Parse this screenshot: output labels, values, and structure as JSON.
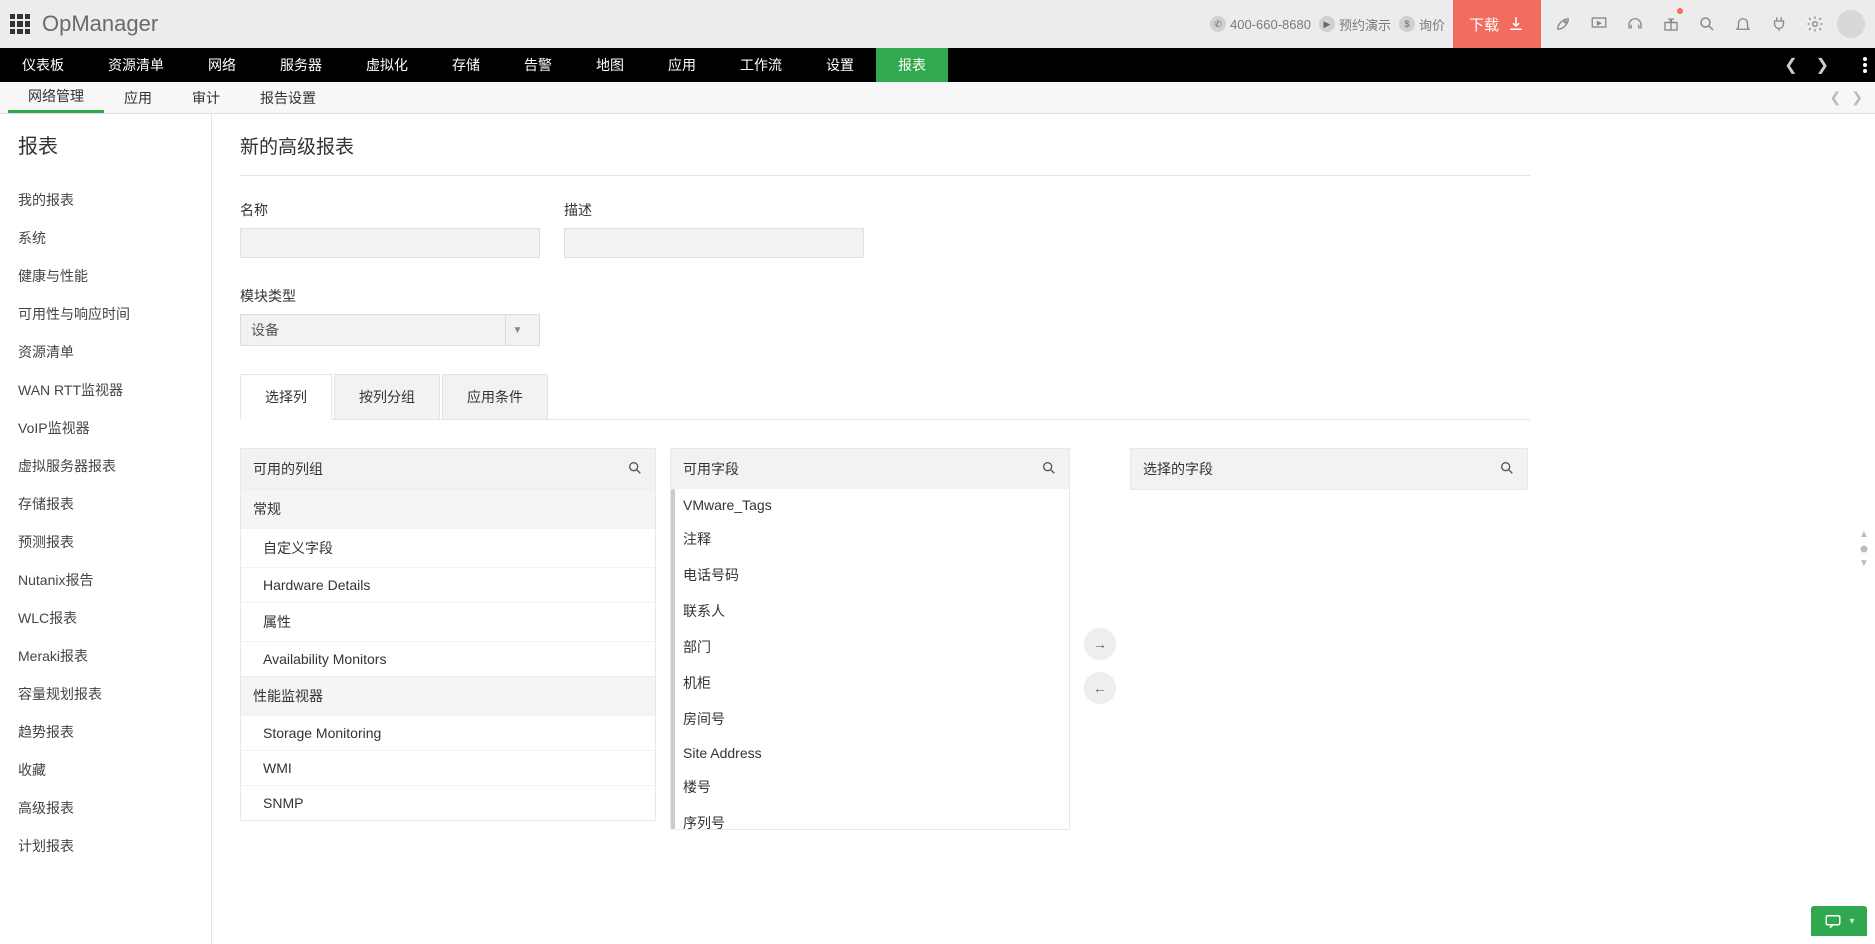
{
  "header": {
    "brand": "OpManager",
    "phone": "400-660-8680",
    "demo": "预约演示",
    "quote": "询价",
    "download": "下载"
  },
  "main_nav": {
    "items": [
      "仪表板",
      "资源清单",
      "网络",
      "服务器",
      "虚拟化",
      "存储",
      "告警",
      "地图",
      "应用",
      "工作流",
      "设置",
      "报表"
    ],
    "active_index": 11
  },
  "sub_nav": {
    "items": [
      "网络管理",
      "应用",
      "审计",
      "报告设置"
    ],
    "active_index": 0
  },
  "sidebar": {
    "title": "报表",
    "items": [
      "我的报表",
      "系统",
      "健康与性能",
      "可用性与响应时间",
      "资源清单",
      "WAN RTT监视器",
      "VoIP监视器",
      "虚拟服务器报表",
      "存储报表",
      "预测报表",
      "Nutanix报告",
      "WLC报表",
      "Meraki报表",
      "容量规划报表",
      "趋势报表",
      "收藏",
      "高级报表",
      "计划报表"
    ]
  },
  "page": {
    "title": "新的高级报表",
    "labels": {
      "name": "名称",
      "description": "描述",
      "module_type": "模块类型"
    },
    "module_type_value": "设备",
    "tabs": [
      "选择列",
      "按列分组",
      "应用条件"
    ],
    "active_tab": 0,
    "panel_a_title": "可用的列组",
    "panel_b_title": "可用字段",
    "panel_c_title": "选择的字段",
    "groups": [
      {
        "name": "常规",
        "items": [
          "自定义字段",
          "Hardware Details",
          "属性",
          "Availability Monitors"
        ]
      },
      {
        "name": "性能监视器",
        "items": [
          "Storage Monitoring",
          "WMI",
          "SNMP"
        ]
      }
    ],
    "fields": [
      "VMware_Tags",
      "注释",
      "电话号码",
      "联系人",
      "部门",
      "机柜",
      "房间号",
      "Site Address",
      "楼号",
      "序列号"
    ]
  }
}
